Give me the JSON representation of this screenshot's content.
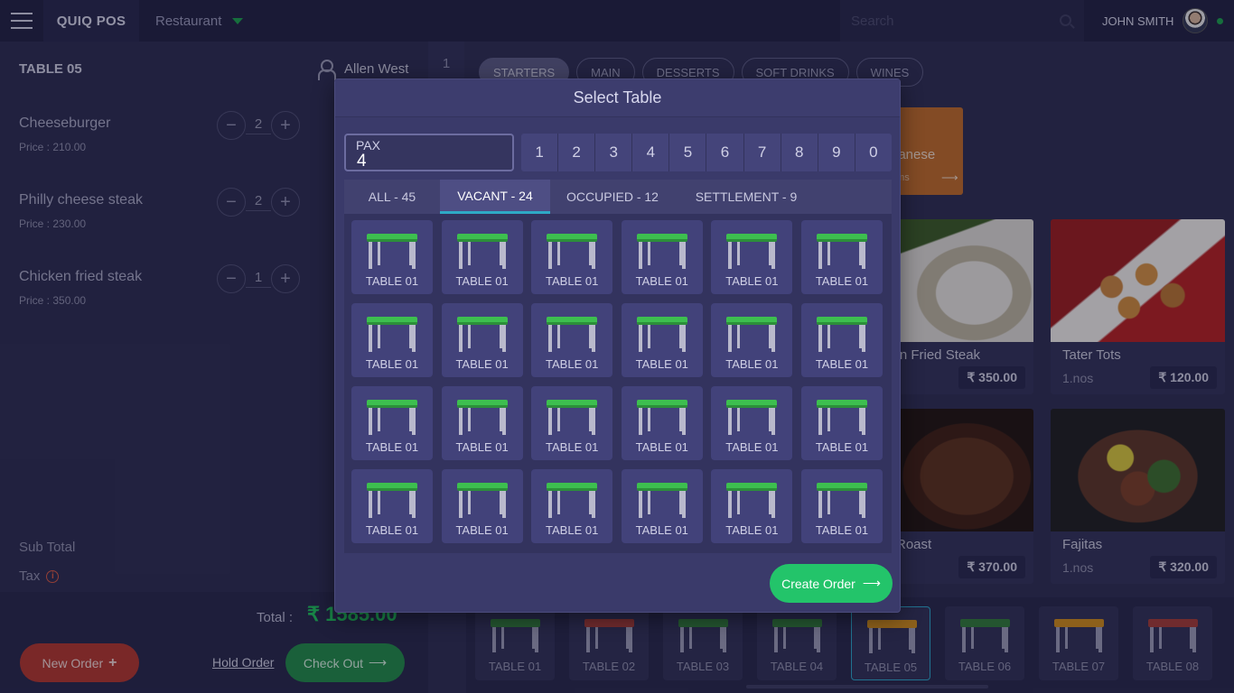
{
  "topbar": {
    "brand": "QUIQ POS",
    "venue": "Restaurant",
    "search_placeholder": "Search",
    "user_name": "JOHN SMITH"
  },
  "order": {
    "table_title": "TABLE 05",
    "waiter": "Allen West",
    "items": [
      {
        "name": "Cheeseburger",
        "price": "Price  : 210.00",
        "qty": "2"
      },
      {
        "name": "Philly cheese steak",
        "price": "Price  : 230.00",
        "qty": "2"
      },
      {
        "name": "Chicken fried steak",
        "price": "Price  : 350.00",
        "qty": "1"
      }
    ],
    "subtotal_label": "Sub Total",
    "tax_label": "Tax",
    "total_label": "Total :",
    "total_value": "₹ 1585.00",
    "new_order": "New Order",
    "hold_order": "Hold Order",
    "check_out": "Check Out"
  },
  "gutter_number": "1",
  "categories": [
    "STARTERS",
    "MAIN",
    "DESSERTS",
    "SOFT DRINKS",
    "WINES"
  ],
  "category_card": {
    "name": "banese",
    "count": "ems",
    "color": "#c06a25"
  },
  "foods": [
    {
      "name": "ken Fried Steak",
      "unit": "",
      "price": "₹ 350.00"
    },
    {
      "name": "Tater Tots",
      "unit": "1.nos",
      "price": "₹ 120.00"
    },
    {
      "name": "Roast",
      "unit": "",
      "price": "₹ 370.00"
    },
    {
      "name": "Fajitas",
      "unit": "1.nos",
      "price": "₹ 320.00"
    }
  ],
  "bottom_tables": [
    {
      "label": "TABLE 01",
      "color": "#2f7a37"
    },
    {
      "label": "TABLE 02",
      "color": "#a33a34"
    },
    {
      "label": "TABLE 03",
      "color": "#2f7a37"
    },
    {
      "label": "TABLE 04",
      "color": "#2f7a37"
    },
    {
      "label": "TABLE 05",
      "color": "#d08a16"
    },
    {
      "label": "TABLE 06",
      "color": "#2f7a37"
    },
    {
      "label": "TABLE 07",
      "color": "#d08a16"
    },
    {
      "label": "TABLE 08",
      "color": "#a33a34"
    }
  ],
  "modal": {
    "title": "Select Table",
    "pax_label": "PAX",
    "pax_value": "4",
    "numpad": [
      "1",
      "2",
      "3",
      "4",
      "5",
      "6",
      "7",
      "8",
      "9",
      "0"
    ],
    "tabs": [
      "ALL - 45",
      "VACANT - 24",
      "OCCUPIED - 12",
      "SETTLEMENT - 9"
    ],
    "active_tab": "VACANT - 24",
    "table_label": "TABLE 01",
    "table_count": 24,
    "vacant_color": "#3dbf4f",
    "create_order": "Create Order"
  }
}
